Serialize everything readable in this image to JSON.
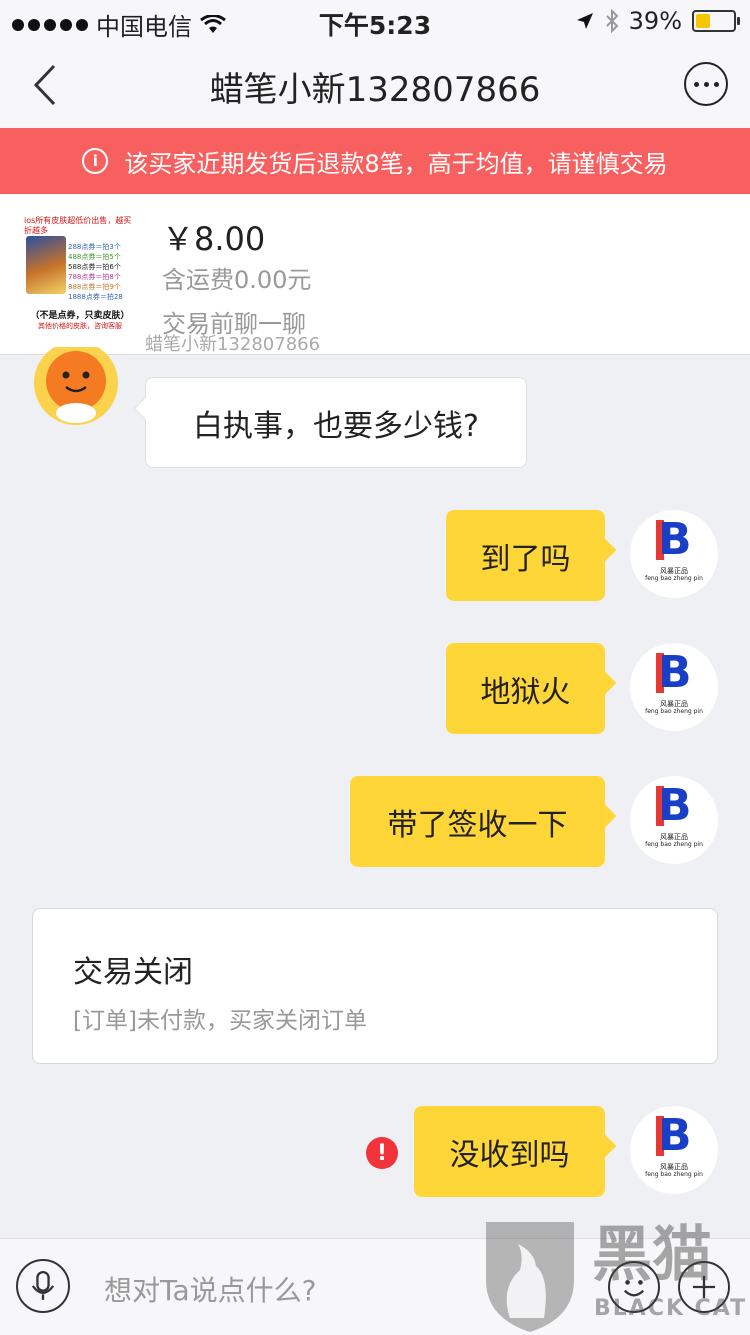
{
  "status_bar": {
    "carrier": "中国电信",
    "time": "下午5:23",
    "battery": "39%",
    "battery_level": 0.39
  },
  "nav": {
    "title": "蜡笔小新132807866"
  },
  "warning": {
    "text": "该买家近期发货后退款8笔，高于均值，请谨慎交易"
  },
  "product": {
    "price": "￥8.00",
    "shipping": "含运费0.00元",
    "chat_hint": "交易前聊一聊",
    "thumb": {
      "headline": "ios所有皮肤超低价出售，越买折越多",
      "rows": [
        "288点券＝拍3个",
        "488点券＝拍5个",
        "588点券＝拍6个",
        "788点券＝拍8个",
        "888点券＝拍9个",
        "1888点券＝拍28"
      ],
      "footer": "（不是点券，只卖皮肤）",
      "note": "其他价格的皮肤，咨询客服"
    }
  },
  "messages": {
    "partner_name": "蜡笔小新132807866",
    "m1": "白执事，也要多少钱?",
    "m2": "到了吗",
    "m3": "地狱火",
    "m4": "带了签收一下",
    "m5": "没收到吗"
  },
  "avatar_b": {
    "letter": "B",
    "caption1": "风暴正品",
    "caption2": "feng bao zheng pin"
  },
  "order_card": {
    "title": "交易关闭",
    "subtitle": "[订单]未付款，买家关闭订单"
  },
  "input": {
    "placeholder": "想对Ta说点什么?"
  },
  "watermark": {
    "cn": "黑猫",
    "en": "BLACK CAT"
  },
  "colors": {
    "warning_bg": "#f8605f",
    "bubble_yellow": "#fed638",
    "error_red": "#f2343a"
  }
}
